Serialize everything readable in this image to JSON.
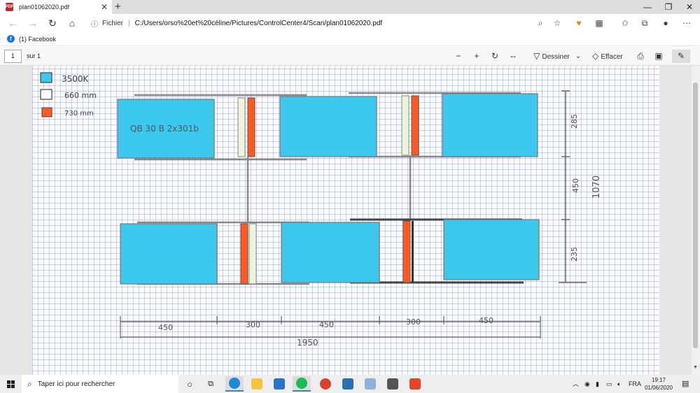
{
  "browser": {
    "tab_title": "plan01062020.pdf",
    "tab_close": "✕",
    "new_tab": "+",
    "window_minimize": "—",
    "window_restore": "❐",
    "window_close": "✕",
    "address_info_icon": "ⓘ",
    "address_scheme": "Fichier",
    "address_separator": "|",
    "address_url": "C:/Users/orso%20et%20céline/Pictures/ControlCenter4/Scan/plan01062020.pdf",
    "favorites": [
      {
        "label": "(1) Facebook",
        "icon": "facebook-icon"
      }
    ]
  },
  "pdf_toolbar": {
    "page_number": "1",
    "page_total_label": "sur 1",
    "draw_label": "Dessiner",
    "erase_label": "Effacer"
  },
  "drawing": {
    "legend": [
      {
        "label": "3500K",
        "swatch": "#3cc8ec"
      },
      {
        "label": "660 mm",
        "swatch": "#ffffff"
      },
      {
        "label": "730 mm",
        "swatch": "#ff5a1f"
      }
    ],
    "box_label": "QB 30 B 2x301b",
    "bottom_dimensions": [
      "450",
      "300",
      "450",
      "300",
      "450"
    ],
    "total_width": "1950",
    "side_dimensions": [
      "285",
      "450",
      "235"
    ],
    "total_height": "1070",
    "colors": {
      "cyan": "#3cc8ec",
      "orange": "#ff5a1f",
      "pencil": "#777777"
    }
  },
  "taskbar": {
    "search_placeholder": "Taper ici pour rechercher",
    "language": "FRA",
    "time": "19:17",
    "date": "01/06/2020"
  }
}
